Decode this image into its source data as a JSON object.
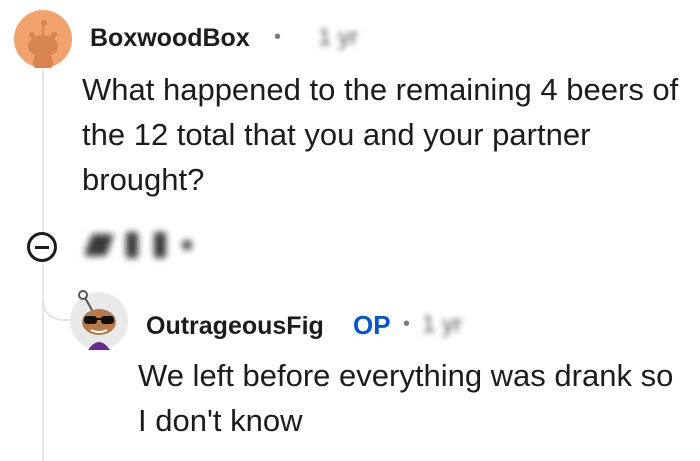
{
  "comment": {
    "username": "BoxwoodBox",
    "separator": "•",
    "timestamp_blurred": "1 yr",
    "text": "What happened to the remaining 4 beers of the 12 total that you and your partner brought?",
    "actions_blurred": "▲ 1 ▼ +"
  },
  "reply": {
    "username": "OutrageousFig",
    "op_badge": "OP",
    "separator": "•",
    "timestamp_blurred": "1 yr",
    "text": "We left before everything was drank so I don't know"
  },
  "icons": {
    "collapse": "collapse-minus-icon",
    "avatar_1": "snoo-avatar-icon",
    "avatar_2": "snoo-sunglasses-avatar-icon"
  },
  "colors": {
    "avatar_1_bg": "#f2a26c",
    "op_badge": "#0a54c7",
    "thread_line": "#e3e5e8"
  }
}
